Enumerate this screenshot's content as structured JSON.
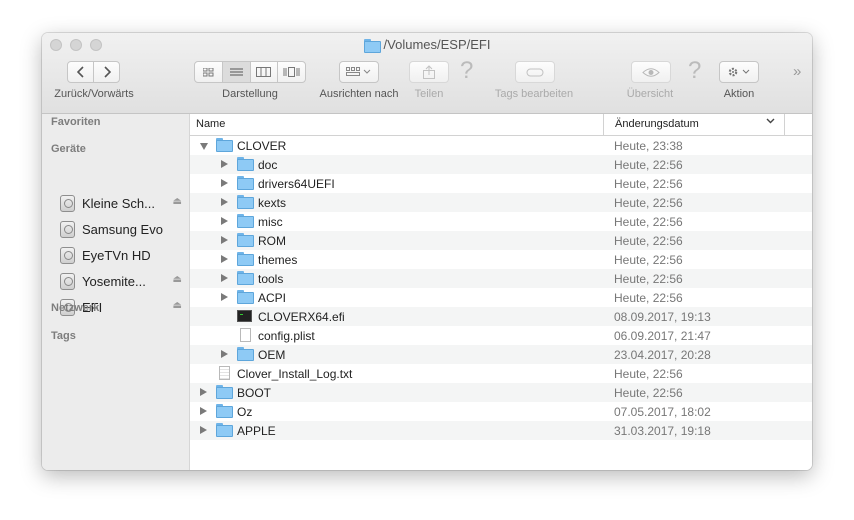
{
  "window": {
    "title": "/Volumes/ESP/EFI"
  },
  "toolbar": {
    "nav_label": "Zurück/Vorwärts",
    "view_label": "Darstellung",
    "arrange_label": "Ausrichten nach",
    "share_label": "Teilen",
    "tags_label": "Tags bearbeiten",
    "quicklook_label": "Übersicht",
    "action_label": "Aktion",
    "help_glyph": "?",
    "overflow_glyph": "»"
  },
  "sidebar": {
    "favorites_header": "Favoriten",
    "devices_header": "Geräte",
    "devices": [
      {
        "label": "Kleine Sch...",
        "ejectable": true
      },
      {
        "label": "Samsung Evo",
        "ejectable": false
      },
      {
        "label": "EyeTVn HD",
        "ejectable": false
      },
      {
        "label": "Yosemite...",
        "ejectable": true
      },
      {
        "label": "EFI",
        "ejectable": true
      }
    ],
    "network_header": "Netzwerk",
    "tags_header": "Tags",
    "eject_glyph": "⏏"
  },
  "columns": {
    "name": "Name",
    "date": "Änderungsdatum"
  },
  "files": [
    {
      "name": "CLOVER",
      "date": "Heute, 23:38",
      "kind": "folder",
      "level": 0,
      "disclosure": "open"
    },
    {
      "name": "doc",
      "date": "Heute, 22:56",
      "kind": "folder",
      "level": 1,
      "disclosure": "closed"
    },
    {
      "name": "drivers64UEFI",
      "date": "Heute, 22:56",
      "kind": "folder",
      "level": 1,
      "disclosure": "closed"
    },
    {
      "name": "kexts",
      "date": "Heute, 22:56",
      "kind": "folder",
      "level": 1,
      "disclosure": "closed"
    },
    {
      "name": "misc",
      "date": "Heute, 22:56",
      "kind": "folder",
      "level": 1,
      "disclosure": "closed"
    },
    {
      "name": "ROM",
      "date": "Heute, 22:56",
      "kind": "folder",
      "level": 1,
      "disclosure": "closed"
    },
    {
      "name": "themes",
      "date": "Heute, 22:56",
      "kind": "folder",
      "level": 1,
      "disclosure": "closed"
    },
    {
      "name": "tools",
      "date": "Heute, 22:56",
      "kind": "folder",
      "level": 1,
      "disclosure": "closed"
    },
    {
      "name": "ACPI",
      "date": "Heute, 22:56",
      "kind": "folder",
      "level": 1,
      "disclosure": "closed"
    },
    {
      "name": "CLOVERX64.efi",
      "date": "08.09.2017, 19:13",
      "kind": "executable",
      "level": 1,
      "disclosure": "none"
    },
    {
      "name": "config.plist",
      "date": "06.09.2017, 21:47",
      "kind": "document",
      "level": 1,
      "disclosure": "none"
    },
    {
      "name": "OEM",
      "date": "23.04.2017, 20:28",
      "kind": "folder",
      "level": 1,
      "disclosure": "closed"
    },
    {
      "name": "Clover_Install_Log.txt",
      "date": "Heute, 22:56",
      "kind": "text",
      "level": 0,
      "disclosure": "none"
    },
    {
      "name": "BOOT",
      "date": "Heute, 22:56",
      "kind": "folder",
      "level": 0,
      "disclosure": "closed"
    },
    {
      "name": "Oz",
      "date": "07.05.2017, 18:02",
      "kind": "folder",
      "level": 0,
      "disclosure": "closed"
    },
    {
      "name": "APPLE",
      "date": "31.03.2017, 19:18",
      "kind": "folder",
      "level": 0,
      "disclosure": "closed"
    }
  ],
  "colors": {
    "folder": "#8ecaf5",
    "sidebar_bg": "#ececec",
    "stripe": "#f4f5f5"
  }
}
